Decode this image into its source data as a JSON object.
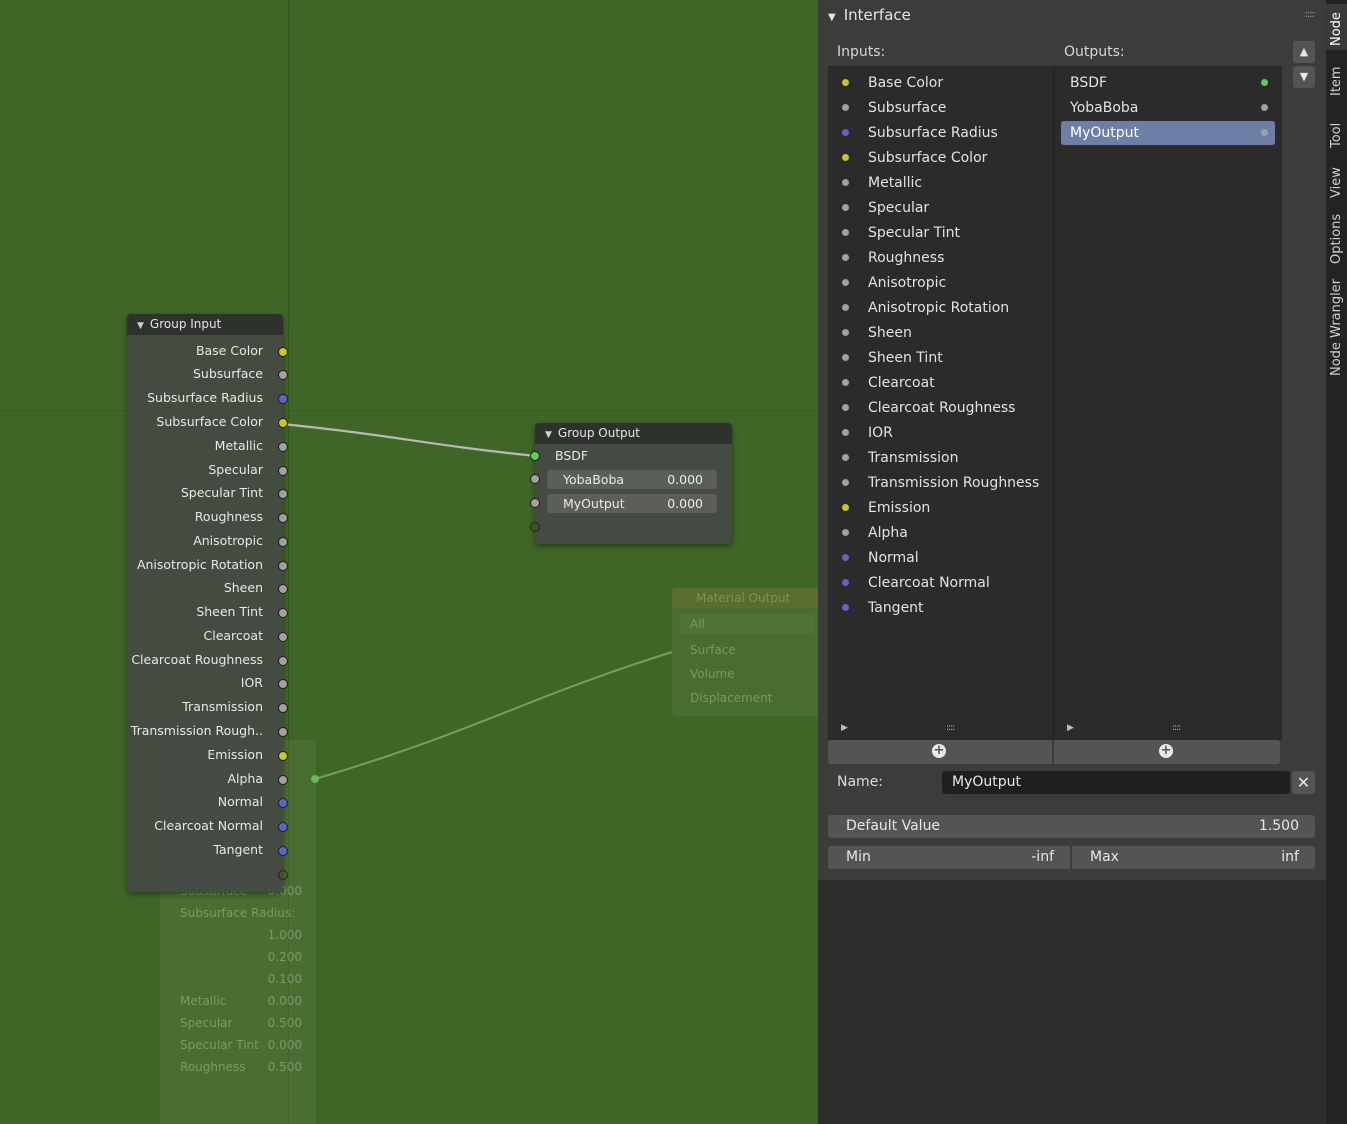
{
  "editor": {
    "background_color": "#3f6626"
  },
  "group_input_node": {
    "title": "Group Input",
    "sockets": [
      {
        "label": "Base Color",
        "color": "#c7c729"
      },
      {
        "label": "Subsurface",
        "color": "#a1a1a1"
      },
      {
        "label": "Subsurface Radius",
        "color": "#6363c7"
      },
      {
        "label": "Subsurface Color",
        "color": "#c7c729"
      },
      {
        "label": "Metallic",
        "color": "#a1a1a1"
      },
      {
        "label": "Specular",
        "color": "#a1a1a1"
      },
      {
        "label": "Specular Tint",
        "color": "#a1a1a1"
      },
      {
        "label": "Roughness",
        "color": "#a1a1a1"
      },
      {
        "label": "Anisotropic",
        "color": "#a1a1a1"
      },
      {
        "label": "Anisotropic Rotation",
        "color": "#a1a1a1"
      },
      {
        "label": "Sheen",
        "color": "#a1a1a1"
      },
      {
        "label": "Sheen Tint",
        "color": "#a1a1a1"
      },
      {
        "label": "Clearcoat",
        "color": "#a1a1a1"
      },
      {
        "label": "Clearcoat Roughness",
        "color": "#a1a1a1"
      },
      {
        "label": "IOR",
        "color": "#a1a1a1"
      },
      {
        "label": "Transmission",
        "color": "#a1a1a1"
      },
      {
        "label": "Transmission Rough..",
        "color": "#a1a1a1"
      },
      {
        "label": "Emission",
        "color": "#c7c729"
      },
      {
        "label": "Alpha",
        "color": "#a1a1a1"
      },
      {
        "label": "Normal",
        "color": "#6363c7"
      },
      {
        "label": "Clearcoat Normal",
        "color": "#6363c7"
      },
      {
        "label": "Tangent",
        "color": "#6363c7"
      }
    ]
  },
  "group_output_node": {
    "title": "Group Output",
    "bsdf_label": "BSDF",
    "fields": [
      {
        "label": "YobaBoba",
        "value": "0.000"
      },
      {
        "label": "MyOutput",
        "value": "0.000"
      }
    ]
  },
  "material_output_node": {
    "title": "Material Output",
    "target": "All",
    "sockets": [
      "Surface",
      "Volume",
      "Displacement"
    ]
  },
  "principled_node_ghost": {
    "rows": [
      {
        "label": "Subsurface",
        "value": "0.000"
      },
      {
        "label": "Subsurface Radius:",
        "value": ""
      },
      {
        "label": "",
        "value": "1.000"
      },
      {
        "label": "",
        "value": "0.200"
      },
      {
        "label": "",
        "value": "0.100"
      },
      {
        "label": "Metallic",
        "value": "0.000"
      },
      {
        "label": "Specular",
        "value": "0.500"
      },
      {
        "label": "Specular Tint",
        "value": "0.000"
      },
      {
        "label": "Roughness",
        "value": "0.500"
      }
    ]
  },
  "interface_panel": {
    "title": "Interface",
    "inputs_label": "Inputs:",
    "outputs_label": "Outputs:",
    "inputs": [
      {
        "label": "Base Color",
        "color": "#c7c729"
      },
      {
        "label": "Subsurface",
        "color": "#a1a1a1"
      },
      {
        "label": "Subsurface Radius",
        "color": "#6363c7"
      },
      {
        "label": "Subsurface Color",
        "color": "#c7c729"
      },
      {
        "label": "Metallic",
        "color": "#a1a1a1"
      },
      {
        "label": "Specular",
        "color": "#a1a1a1"
      },
      {
        "label": "Specular Tint",
        "color": "#a1a1a1"
      },
      {
        "label": "Roughness",
        "color": "#a1a1a1"
      },
      {
        "label": "Anisotropic",
        "color": "#a1a1a1"
      },
      {
        "label": "Anisotropic Rotation",
        "color": "#a1a1a1"
      },
      {
        "label": "Sheen",
        "color": "#a1a1a1"
      },
      {
        "label": "Sheen Tint",
        "color": "#a1a1a1"
      },
      {
        "label": "Clearcoat",
        "color": "#a1a1a1"
      },
      {
        "label": "Clearcoat Roughness",
        "color": "#a1a1a1"
      },
      {
        "label": "IOR",
        "color": "#a1a1a1"
      },
      {
        "label": "Transmission",
        "color": "#a1a1a1"
      },
      {
        "label": "Transmission Roughness",
        "color": "#a1a1a1"
      },
      {
        "label": "Emission",
        "color": "#c7c729"
      },
      {
        "label": "Alpha",
        "color": "#a1a1a1"
      },
      {
        "label": "Normal",
        "color": "#6363c7"
      },
      {
        "label": "Clearcoat Normal",
        "color": "#6363c7"
      },
      {
        "label": "Tangent",
        "color": "#6363c7"
      }
    ],
    "outputs": [
      {
        "label": "BSDF",
        "color": "#63c763",
        "selected": false
      },
      {
        "label": "YobaBoba",
        "color": "#a1a1a1",
        "selected": false
      },
      {
        "label": "MyOutput",
        "color": "#a1a1a1",
        "selected": true
      }
    ],
    "name_label": "Name:",
    "name_value": "MyOutput",
    "default_value_label": "Default Value",
    "default_value": "1.500",
    "min_label": "Min",
    "min_value": "-inf",
    "max_label": "Max",
    "max_value": "inf",
    "selected_color": "#6d7fa6"
  },
  "sidebar_tabs": [
    "Node",
    "Item",
    "Tool",
    "View",
    "Options",
    "Node Wrangler"
  ],
  "active_tab": "Node"
}
